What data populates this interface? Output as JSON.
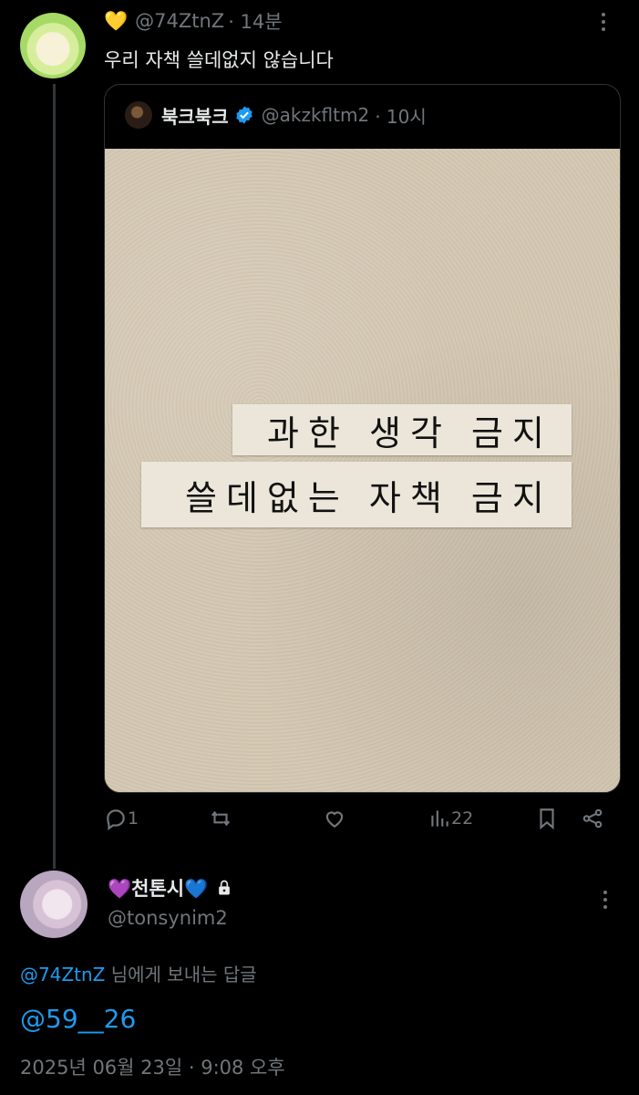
{
  "tweet": {
    "name_emoji": "💛",
    "handle": "@74ZtnZ",
    "time": "· 14분",
    "text": "우리 자책 쓸데없지 않습니다"
  },
  "quote": {
    "name": "북크북크",
    "handle": "@akzkfltm2",
    "time": "· 10시",
    "photo_text_line1": "과한 생각 금지",
    "photo_text_line2": "쓸데없는 자책 금지"
  },
  "actions": {
    "reply_count": "1",
    "retweet_count": "",
    "like_count": "",
    "views_count": "22"
  },
  "reply": {
    "name": "💜천톤시💙",
    "handle": "@tonsynim2",
    "reply_to_mention": "@74ZtnZ",
    "reply_to_suffix": " 님에게 보내는 답글",
    "body": "@59__26",
    "datetime": "2025년 06월 23일 · 9:08 오후"
  },
  "colors": {
    "background": "#000000",
    "text": "#e7e9ea",
    "muted": "#71767b",
    "link": "#1d9bf0",
    "border": "#2f3336"
  }
}
